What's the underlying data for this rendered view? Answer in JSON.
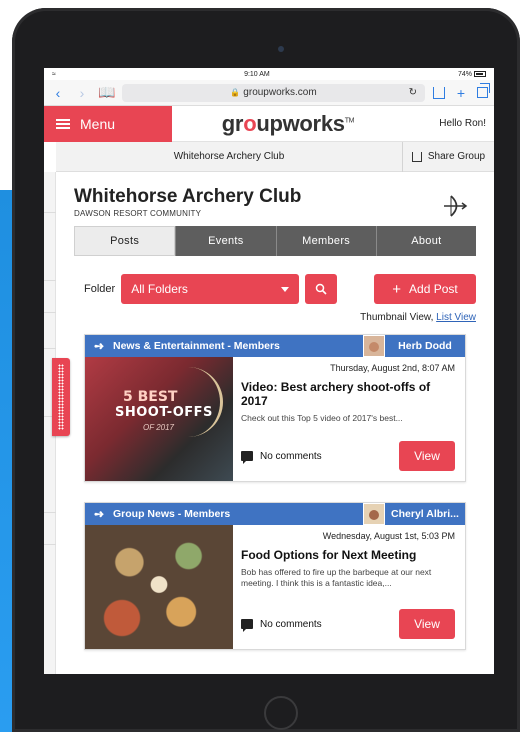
{
  "status": {
    "time": "9:10 AM",
    "battery": "74%"
  },
  "browser": {
    "url": "groupworks.com"
  },
  "header": {
    "menu_label": "Menu",
    "logo_pre": "gr",
    "logo_o": "o",
    "logo_post": "upworks",
    "logo_tm": "TM",
    "greeting": "Hello Ron!"
  },
  "groupbar": {
    "name": "Whitehorse Archery Club",
    "share_label": "Share Group"
  },
  "club": {
    "title": "Whitehorse Archery Club",
    "subtitle": "DAWSON RESORT COMMUNITY"
  },
  "tabs": [
    {
      "label": "Posts"
    },
    {
      "label": "Events"
    },
    {
      "label": "Members"
    },
    {
      "label": "About"
    }
  ],
  "folder": {
    "label": "Folder",
    "selected": "All Folders"
  },
  "add_post_label": "Add Post",
  "view_toggle": {
    "current": "Thumbnail View,",
    "alt_link": "List View"
  },
  "posts": [
    {
      "category": "News & Entertainment - Members",
      "author": "Herb Dodd",
      "date": "Thursday, August 2nd, 8:07 AM",
      "title": "Video: Best archery shoot-offs of 2017",
      "excerpt": "Check out this Top 5 video of 2017's best...",
      "comments": "No comments",
      "view_label": "View",
      "thumb_text": {
        "line1": "5 BEST",
        "line2": "SHOOT-OFFS",
        "line3": "OF 2017"
      }
    },
    {
      "category": "Group News - Members",
      "author": "Cheryl Albri...",
      "date": "Wednesday, August 1st, 5:03 PM",
      "title": "Food Options for Next Meeting",
      "excerpt": "Bob has offered to fire up the barbeque at our next meeting. I think this is a fantastic idea,...",
      "comments": "No comments",
      "view_label": "View"
    }
  ],
  "colors": {
    "accent": "#e84553",
    "post_header": "#3f73c2",
    "tab_inactive": "#5e5e5e"
  }
}
